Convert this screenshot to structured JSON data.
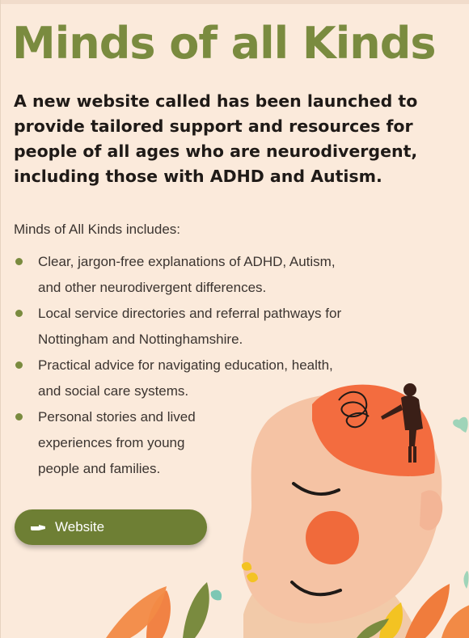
{
  "title": "Minds of all Kinds",
  "intro": "A new website called has been launched to provide tailored support and resources for people of all ages who are neurodivergent, including those with ADHD and Autism.",
  "includes_label": "Minds of All Kinds includes:",
  "list_items": [
    [
      "Clear, jargon-free explanations of ADHD, Autism,",
      "and other neurodivergent differences."
    ],
    [
      "Local service directories and referral pathways for",
      "Nottingham and Nottinghamshire."
    ],
    [
      "Practical advice for navigating education, health,",
      "and social care systems."
    ],
    [
      "Personal stories and lived",
      "experiences from young",
      "people and families."
    ]
  ],
  "button": {
    "label": "Website",
    "icon": "pointing-hand-icon"
  },
  "colors": {
    "background": "#fbeadb",
    "accent_green": "#7a8b3f",
    "button_green": "#6e7f34",
    "text_dark": "#1f1a17",
    "text_body": "#3b3430"
  }
}
